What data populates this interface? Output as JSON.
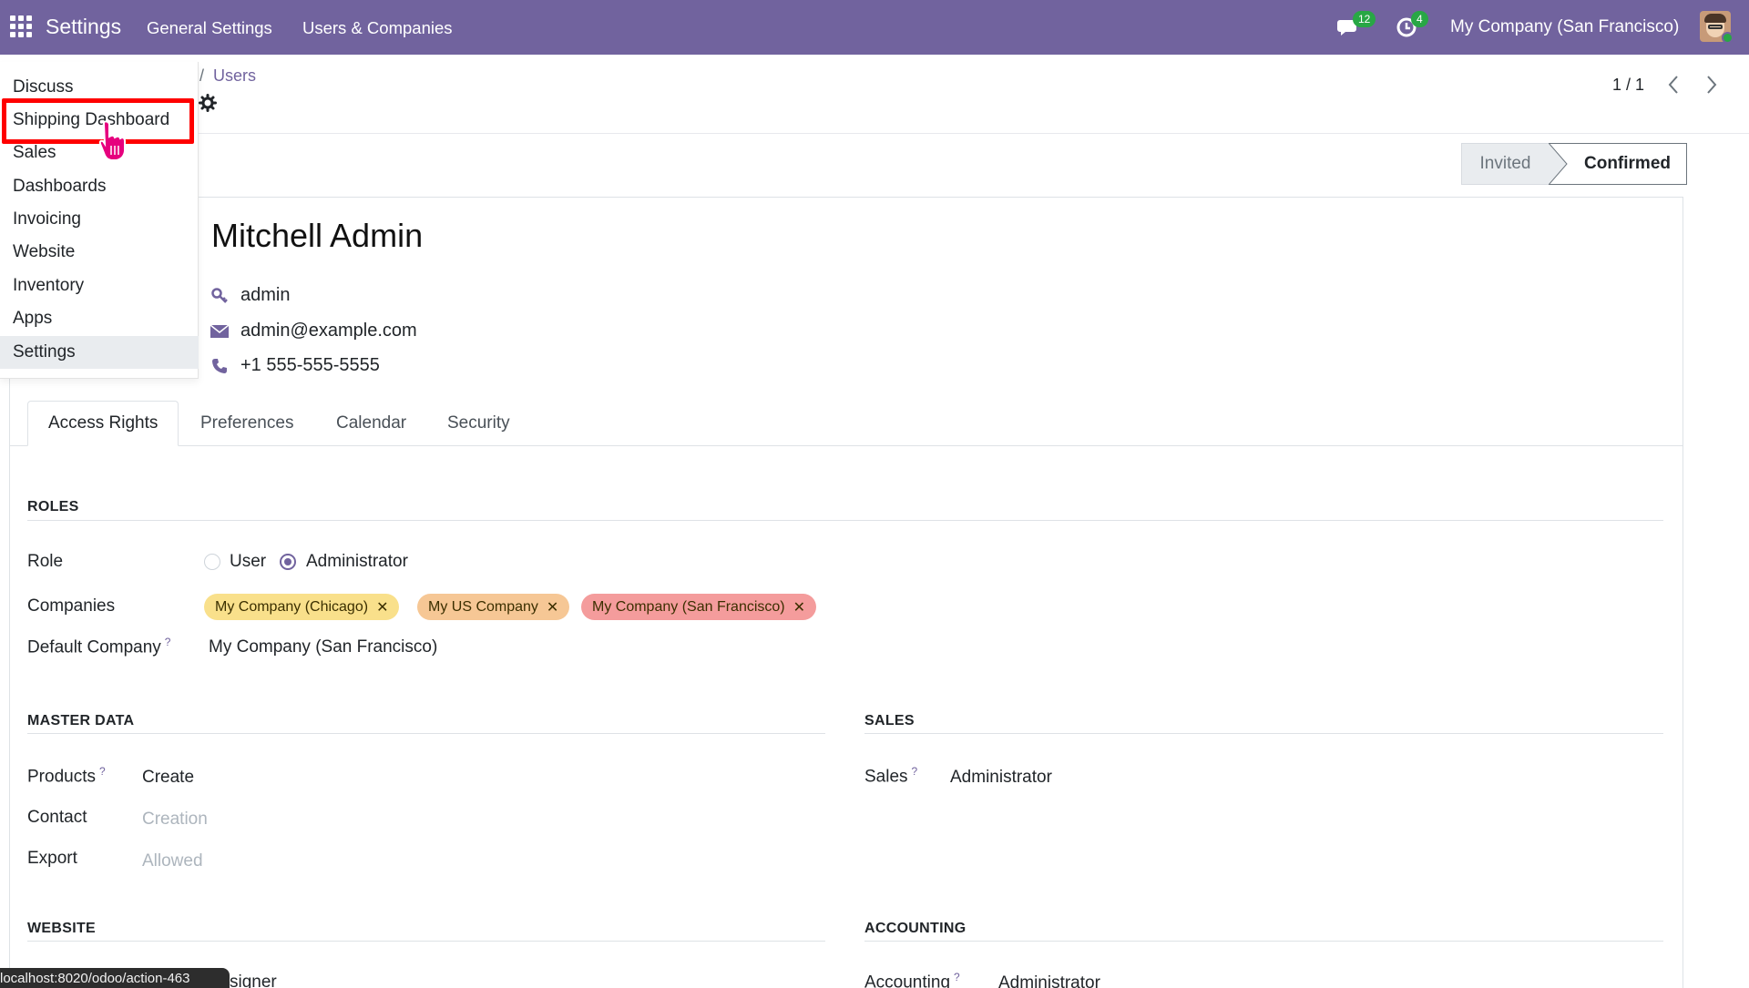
{
  "navbar": {
    "brand": "Settings",
    "menus": [
      "General Settings",
      "Users & Companies"
    ],
    "messages_badge": "12",
    "activities_badge": "4",
    "company": "My Company (San Francisco)"
  },
  "breadcrumb": {
    "separator": "/",
    "current": "Users"
  },
  "pager": {
    "text": "1 / 1"
  },
  "status": {
    "invited": "Invited",
    "confirmed": "Confirmed"
  },
  "user": {
    "name": "Mitchell Admin",
    "login": "admin",
    "email": "admin@example.com",
    "phone": "+1 555-555-5555"
  },
  "tabs": [
    "Access Rights",
    "Preferences",
    "Calendar",
    "Security"
  ],
  "roles": {
    "title": "ROLES",
    "role_label": "Role",
    "role_options": [
      "User",
      "Administrator"
    ],
    "companies_label": "Companies",
    "companies": [
      {
        "name": "My Company (Chicago)",
        "color": "#f9e08b"
      },
      {
        "name": "My US Company",
        "color": "#f6c795"
      },
      {
        "name": "My Company (San Francisco)",
        "color": "#f49c9c"
      }
    ],
    "default_company_label": "Default Company",
    "default_company_help": "?",
    "default_company_value": "My Company (San Francisco)"
  },
  "master_data": {
    "title": "MASTER DATA",
    "products_label": "Products",
    "products_help": "?",
    "products_value": "Create",
    "contact_label": "Contact",
    "contact_value": "Creation",
    "export_label": "Export",
    "export_value": "Allowed"
  },
  "sales": {
    "title": "SALES",
    "sales_label": "Sales",
    "sales_help": "?",
    "sales_value": "Administrator"
  },
  "website": {
    "title": "WEBSITE",
    "partial_value": "signer"
  },
  "accounting": {
    "title": "ACCOUNTING",
    "accounting_label": "Accounting",
    "accounting_help": "?",
    "accounting_value": "Administrator"
  },
  "apps_menu": [
    "Discuss",
    "Shipping Dashboard",
    "Sales",
    "Dashboards",
    "Invoicing",
    "Website",
    "Inventory",
    "Apps",
    "Settings"
  ],
  "url_tooltip": "localhost:8020/odoo/action-463",
  "colors": {
    "brand": "#71639e",
    "highlight": "#ff0000",
    "badge": "#28a745"
  }
}
